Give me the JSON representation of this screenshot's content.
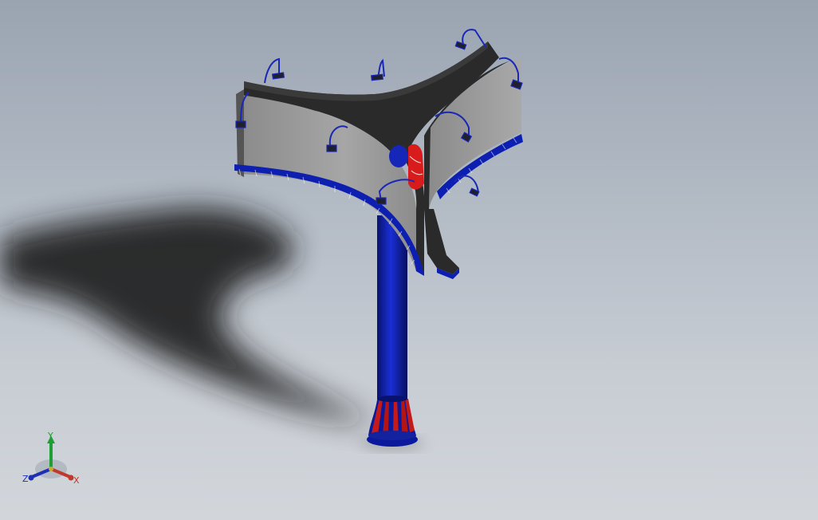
{
  "viewport": {
    "background_top": "#9aa4b1",
    "background_bottom": "#d2d6db"
  },
  "model": {
    "description_icon": "billboard-3d-model-icon",
    "colors": {
      "pole": "#0c1fa3",
      "frame_top": "#2a2a2a",
      "panel": "#9a9a9a",
      "accent_red": "#d81b1b",
      "lamp_wire": "#1a28b8"
    }
  },
  "triad": {
    "x_label": "X",
    "y_label": "Y",
    "z_label": "Z",
    "x_color": "#c0392b",
    "y_color": "#1e9e34",
    "z_color": "#1f2fb3"
  }
}
